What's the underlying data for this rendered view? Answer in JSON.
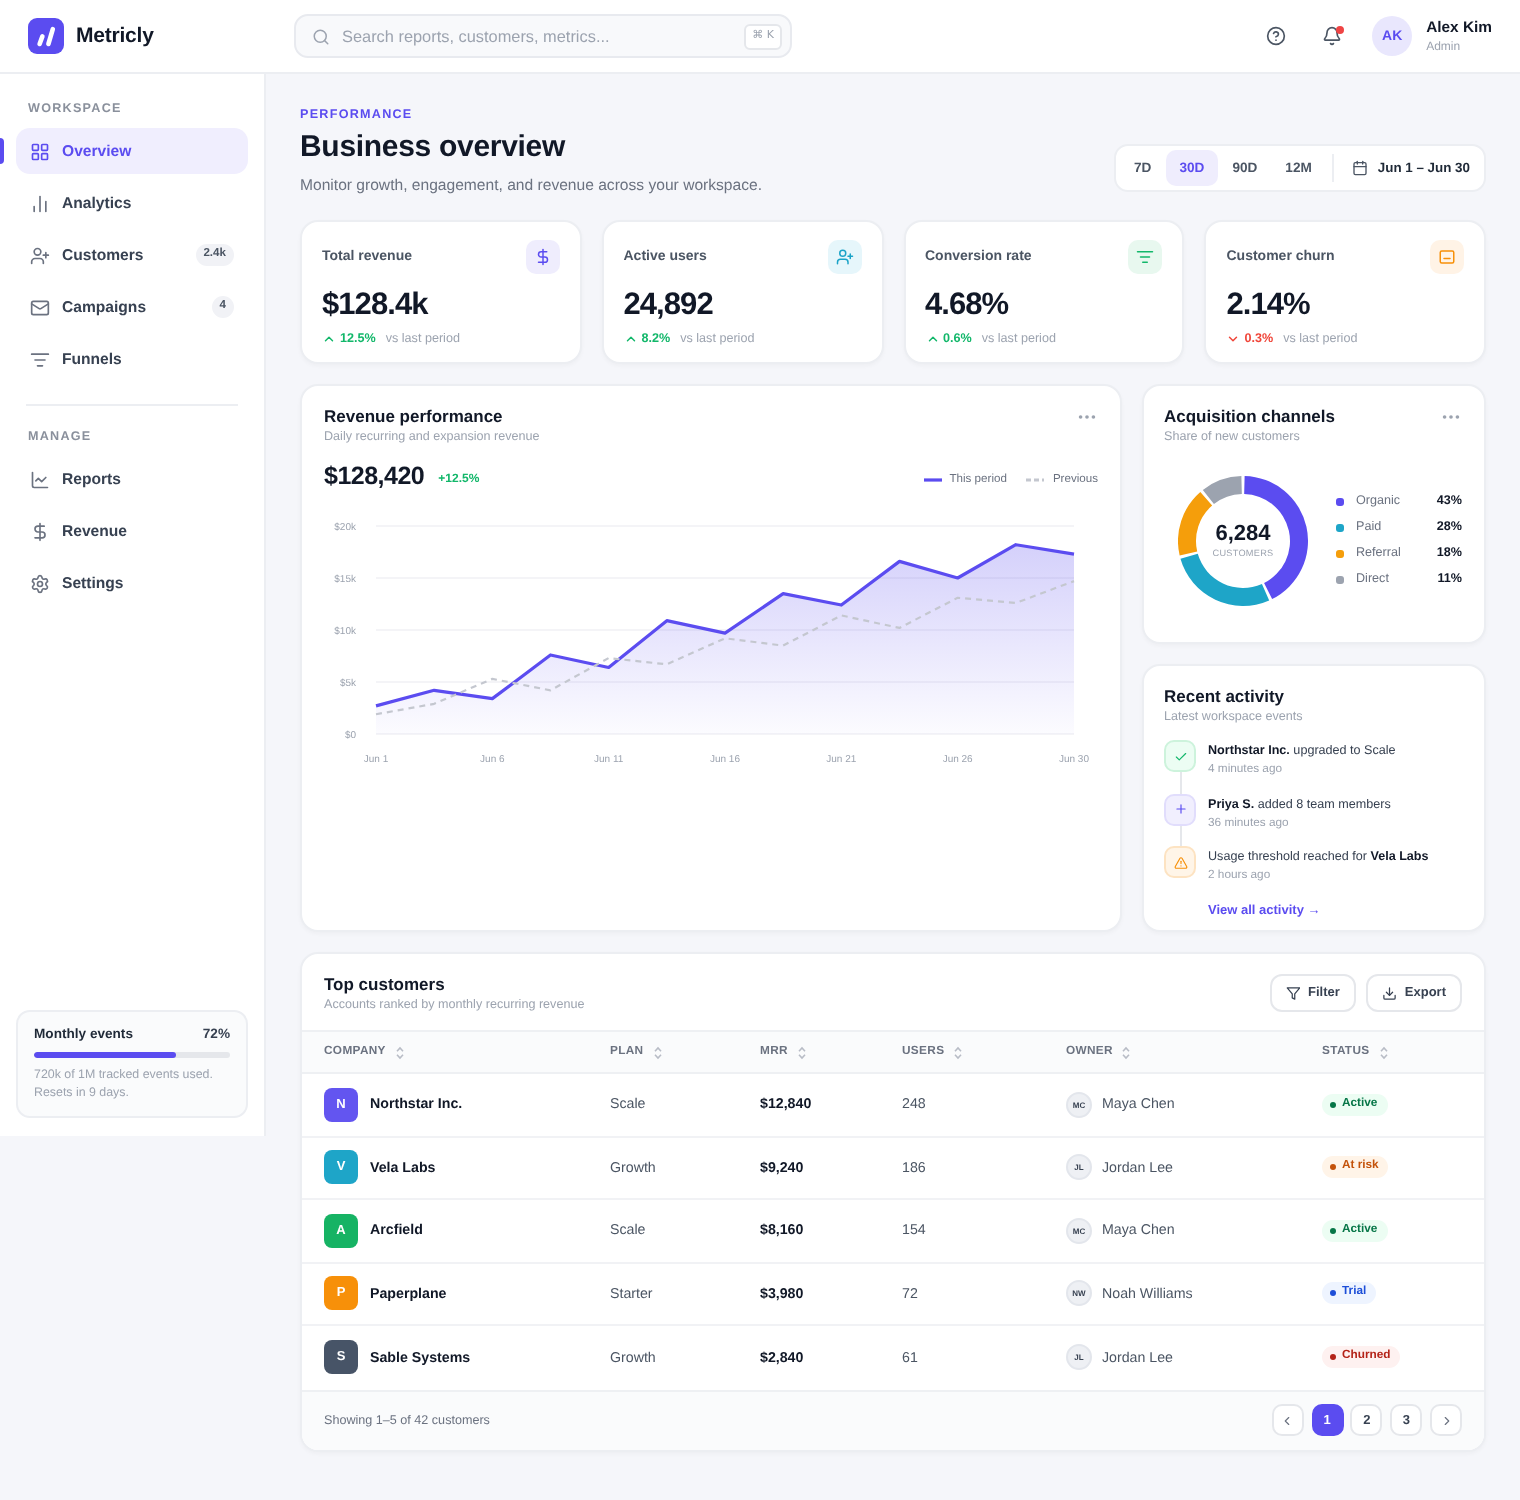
{
  "header": {
    "brand": "Metricly",
    "search": {
      "placeholder": "Search reports, customers, metrics...",
      "shortcut": "⌘ K"
    },
    "notifications": {
      "unread": true
    },
    "user": {
      "initials": "AK",
      "name": "Alex Kim",
      "role": "Admin"
    }
  },
  "sidebar": {
    "sections": [
      {
        "title": "WORKSPACE",
        "items": [
          {
            "label": "Overview",
            "selected": true
          },
          {
            "label": "Analytics",
            "selected": false
          },
          {
            "label": "Customers",
            "badge": "2.4k",
            "selected": false
          },
          {
            "label": "Campaigns",
            "badge": "4",
            "selected": false
          },
          {
            "label": "Funnels",
            "selected": false
          }
        ]
      },
      {
        "title": "MANAGE",
        "items": [
          {
            "label": "Reports",
            "selected": false
          },
          {
            "label": "Revenue",
            "selected": false
          },
          {
            "label": "Settings",
            "selected": false
          }
        ]
      }
    ],
    "usage": {
      "title": "Monthly events",
      "percent": "72%",
      "level": 0.72,
      "note": "720k of 1M tracked events used. Resets in 9 days."
    }
  },
  "page": {
    "eyebrow": "PERFORMANCE",
    "title": "Business overview",
    "subtitle": "Monitor growth, engagement, and revenue across your workspace.",
    "ranges": [
      {
        "label": "7D",
        "selected": false
      },
      {
        "label": "30D",
        "selected": true
      },
      {
        "label": "90D",
        "selected": false
      },
      {
        "label": "12M",
        "selected": false
      }
    ],
    "date_range": "Jun 1 – Jun 30"
  },
  "stats": [
    {
      "label": "Total revenue",
      "value": "$128.4k",
      "change": "12.5%",
      "kind": "up",
      "note": "vs last period"
    },
    {
      "label": "Active users",
      "value": "24,892",
      "change": "8.2%",
      "kind": "up",
      "note": "vs last period"
    },
    {
      "label": "Conversion rate",
      "value": "4.68%",
      "change": "0.6%",
      "kind": "up",
      "note": "vs last period"
    },
    {
      "label": "Customer churn",
      "value": "2.14%",
      "change": "0.3%",
      "kind": "down",
      "note": "vs last period"
    }
  ],
  "revenue": {
    "title": "Revenue performance",
    "subtitle": "Daily recurring and expansion revenue",
    "total": "$128,420",
    "change": "+12.5%",
    "chart_data": {
      "type": "line",
      "grid": true,
      "categories": [
        "Jun 1",
        null,
        "Jun 6",
        null,
        "Jun 11",
        null,
        "Jun 16",
        null,
        "Jun 21",
        null,
        "Jun 26",
        null,
        "Jun 30"
      ],
      "ylim": [
        0,
        20000
      ],
      "yticks": [
        {
          "value": 0,
          "label": "$0"
        },
        {
          "value": 5000,
          "label": "$5k"
        },
        {
          "value": 10000,
          "label": "$10k"
        },
        {
          "value": 15000,
          "label": "$15k"
        },
        {
          "value": 20000,
          "label": "$20k"
        }
      ],
      "series": [
        {
          "name": "This period",
          "color": "#5b4cf0",
          "type": "area",
          "line_style": "solid",
          "values": [
            2700,
            4200,
            3400,
            7600,
            6400,
            10900,
            9700,
            13500,
            12400,
            16600,
            15000,
            18200,
            17300
          ]
        },
        {
          "name": "Previous",
          "color": "#c4c7cf",
          "type": "line",
          "line_style": "dashed",
          "values": [
            1900,
            2900,
            5300,
            4200,
            7300,
            6700,
            9200,
            8500,
            11400,
            10200,
            13100,
            12600,
            14700
          ]
        }
      ]
    }
  },
  "acquisition": {
    "title": "Acquisition channels",
    "subtitle": "Share of new customers",
    "total": "6,284",
    "total_label": "CUSTOMERS",
    "chart_data": {
      "type": "donut",
      "categories": [
        "Organic",
        "Paid",
        "Referral",
        "Direct"
      ],
      "values": [
        43,
        28,
        18,
        11
      ],
      "colors": [
        "#5b4cf0",
        "#1ea5c8",
        "#f59e0b",
        "#9ca3af"
      ],
      "value_labels": [
        "43%",
        "28%",
        "18%",
        "11%"
      ]
    }
  },
  "activity": {
    "title": "Recent activity",
    "subtitle": "Latest workspace events",
    "items": [
      {
        "kind": "success",
        "text": "**Northstar Inc.** upgraded to Scale",
        "time": "4 minutes ago"
      },
      {
        "kind": "info",
        "text": "**Priya S.** added 8 team members",
        "time": "36 minutes ago"
      },
      {
        "kind": "warning",
        "text": "Usage threshold reached for **Vela Labs**",
        "time": "2 hours ago"
      }
    ],
    "link": "View all activity →"
  },
  "customers": {
    "title": "Top customers",
    "subtitle": "Accounts ranked by monthly recurring revenue",
    "buttons": [
      "Filter",
      "Export"
    ],
    "columns": [
      "COMPANY",
      "PLAN",
      "MRR",
      "USERS",
      "OWNER",
      "STATUS"
    ],
    "rows": [
      {
        "initial": "N",
        "color": "#6355f0",
        "company": "Northstar Inc.",
        "plan": "Scale",
        "mrr": "$12,840",
        "users": "248",
        "owner_initials": "MC",
        "owner": "Maya Chen",
        "status": {
          "label": "Active",
          "kind": "active"
        }
      },
      {
        "initial": "V",
        "color": "#1ea5c8",
        "company": "Vela Labs",
        "plan": "Growth",
        "mrr": "$9,240",
        "users": "186",
        "owner_initials": "JL",
        "owner": "Jordan Lee",
        "status": {
          "label": "At risk",
          "kind": "risk"
        }
      },
      {
        "initial": "A",
        "color": "#16b364",
        "company": "Arcfield",
        "plan": "Scale",
        "mrr": "$8,160",
        "users": "154",
        "owner_initials": "MC",
        "owner": "Maya Chen",
        "status": {
          "label": "Active",
          "kind": "active"
        }
      },
      {
        "initial": "P",
        "color": "#f79009",
        "company": "Paperplane",
        "plan": "Starter",
        "mrr": "$3,980",
        "users": "72",
        "owner_initials": "NW",
        "owner": "Noah Williams",
        "status": {
          "label": "Trial",
          "kind": "trial"
        }
      },
      {
        "initial": "S",
        "color": "#475467",
        "company": "Sable Systems",
        "plan": "Growth",
        "mrr": "$2,840",
        "users": "61",
        "owner_initials": "JL",
        "owner": "Jordan Lee",
        "status": {
          "label": "Churned",
          "kind": "churned"
        }
      }
    ],
    "summary": "Showing 1–5 of 42 customers",
    "pages": [
      {
        "label": "1",
        "selected": true
      },
      {
        "label": "2",
        "selected": false
      },
      {
        "label": "3",
        "selected": false
      }
    ]
  }
}
